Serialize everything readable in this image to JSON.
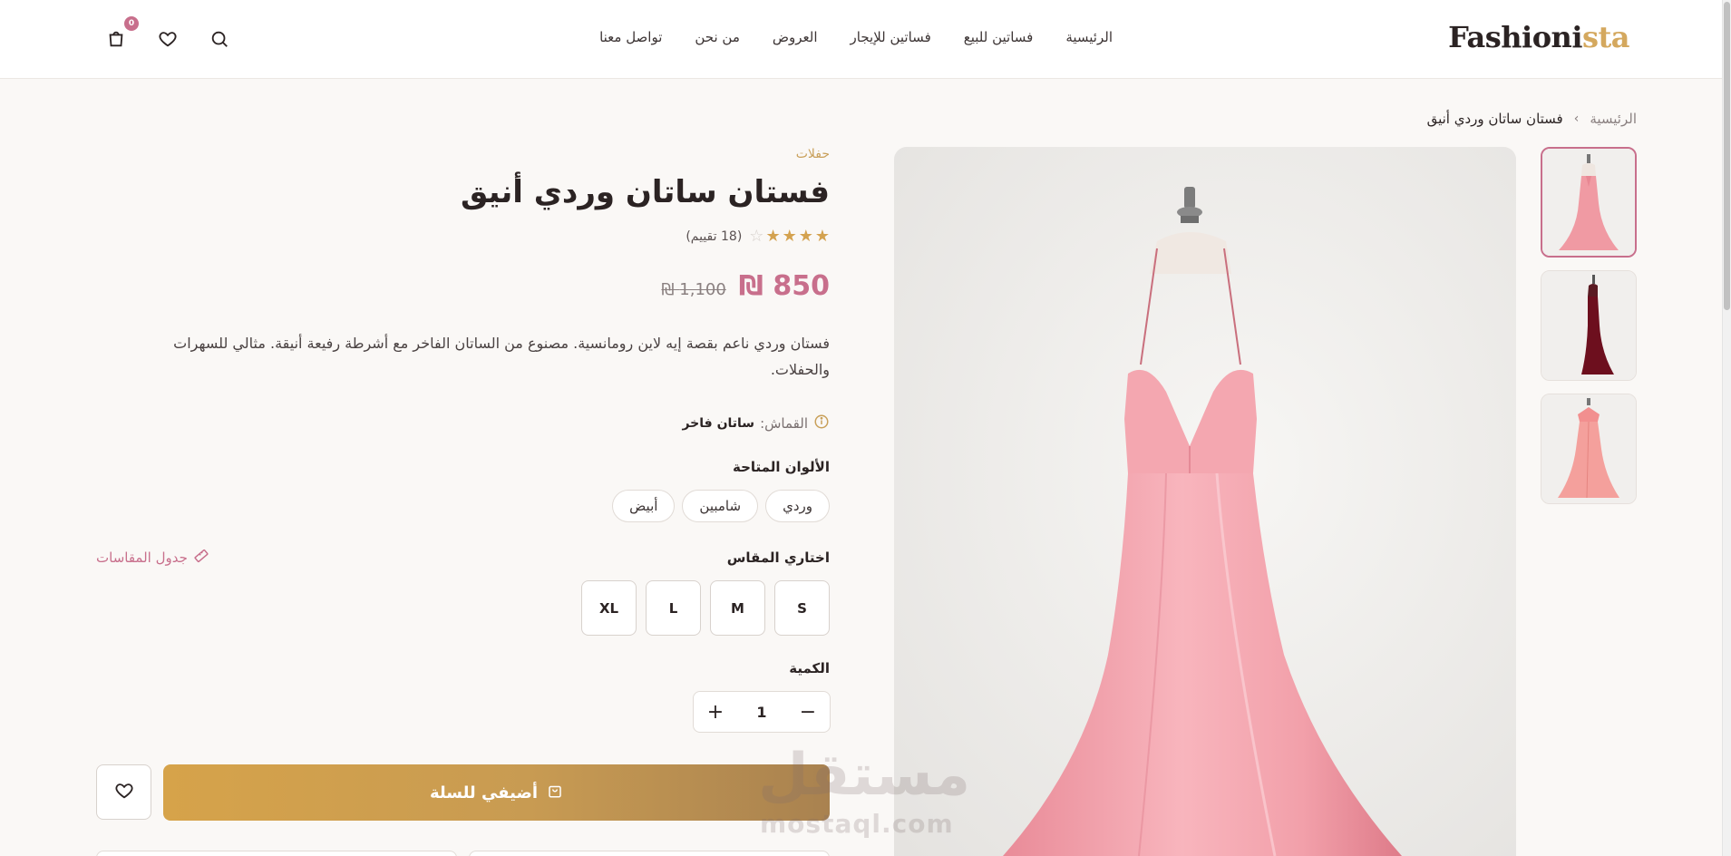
{
  "brand": {
    "name_main": "Fashioni",
    "name_accent": "sta"
  },
  "nav": [
    "الرئيسية",
    "فساتين للبيع",
    "فساتين للإيجار",
    "العروض",
    "من نحن",
    "تواصل معنا"
  ],
  "header": {
    "cart_count": "0"
  },
  "breadcrumb": {
    "home": "الرئيسية",
    "separator": "›",
    "current": "فستان ساتان وردي أنيق"
  },
  "product": {
    "category": "حفلات",
    "title": "فستان ساتان وردي أنيق",
    "rating": 4,
    "rating_max": 5,
    "reviews": "(18 تقييم)",
    "price": "850 ₪",
    "old_price": "1,100 ₪",
    "description": "فستان وردي ناعم بقصة إيه لاين رومانسية. مصنوع من الساتان الفاخر مع أشرطة رفيعة أنيقة. مثالي للسهرات والحفلات.",
    "fabric_label": "القماش:",
    "fabric_value": "ساتان فاخر",
    "colors_title": "الألوان المتاحة",
    "colors": [
      "وردي",
      "شامبين",
      "أبيض"
    ],
    "size_title": "اختاري المقاس",
    "size_chart": "جدول المقاسات",
    "sizes": [
      "S",
      "M",
      "L",
      "XL"
    ],
    "qty_title": "الكمية",
    "qty": "1",
    "add_to_cart": "أضيفي للسلة"
  },
  "watermark": {
    "arabic": "مستقل",
    "latin": "mostaql.com"
  },
  "colors": {
    "accent_pink": "#c86f8c",
    "gold": "#c9a05a",
    "star": "#d4a24f"
  }
}
